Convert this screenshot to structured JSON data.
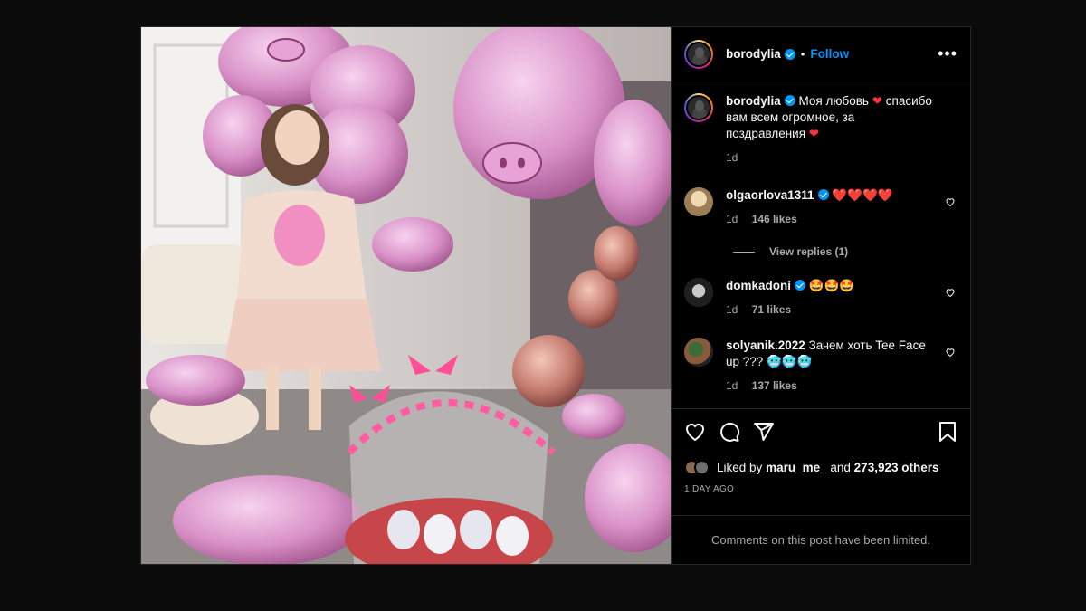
{
  "post": {
    "author": "borodylia",
    "follow_label": "Follow",
    "dot": "•",
    "more": "•••",
    "caption": {
      "username": "borodylia",
      "text_1": "Моя любовь",
      "text_2": "спасибо вам всем огромное, за поздравления",
      "time": "1d"
    },
    "comments": [
      {
        "username": "olgaorlova1311",
        "verified": true,
        "text": "❤️❤️❤️❤️",
        "time": "1d",
        "likes": "146 likes"
      },
      {
        "username": "domkadoni",
        "verified": true,
        "text": "🤩🤩🤩",
        "time": "1d",
        "likes": "71 likes"
      },
      {
        "username": "solyanik.2022",
        "verified": false,
        "text": "Зачем хоть Tee Face up ??? 🥶🥶🥶",
        "time": "1d",
        "likes": "137 likes"
      }
    ],
    "view_replies": "View replies (1)",
    "liked_by": {
      "prefix": "Liked by",
      "user": "maru_me_",
      "middle": "and",
      "count": "273,923 others"
    },
    "timestamp": "1 DAY AGO",
    "limited_notice": "Comments on this post have been limited.",
    "colors": {
      "accent": "#0095f6",
      "heart": "#ff3040",
      "muted": "#a8a8a8"
    }
  }
}
